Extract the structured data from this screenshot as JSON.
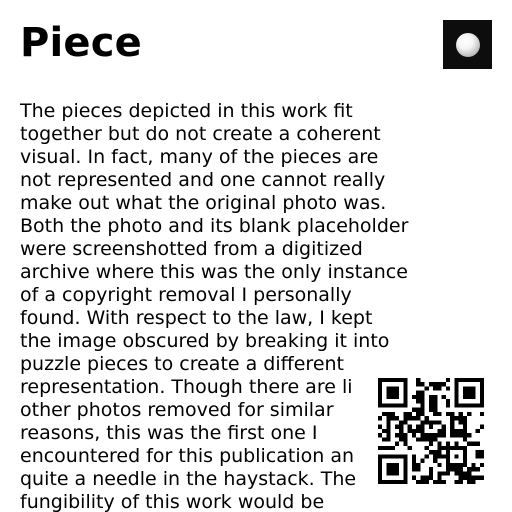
{
  "title": "Piece",
  "thumbnail": {
    "icon": "sphere-icon",
    "background_color": "#0d0d0d"
  },
  "description_lines": [
    "The pieces depicted in this work fit",
    "together but do not create a coherent",
    "visual. In fact, many of the pieces are",
    "not represented and one cannot really",
    "make out what the original photo was.",
    "Both the photo and its blank placeholder",
    "were screenshotted from a digitized",
    "archive where this was the only instance",
    "of a copyright removal I personally",
    "found. With respect to the law, I kept",
    "the image obscured by breaking it into",
    "puzzle pieces to create a different",
    "representation. Though there are li",
    "other photos removed for similar",
    "reasons, this was the first one I",
    "encountered for this publication an",
    "quite a needle in the haystack. The",
    "fungibility of this work would be"
  ],
  "qr_code": {
    "icon": "qr-code-icon",
    "color": "#000000"
  }
}
